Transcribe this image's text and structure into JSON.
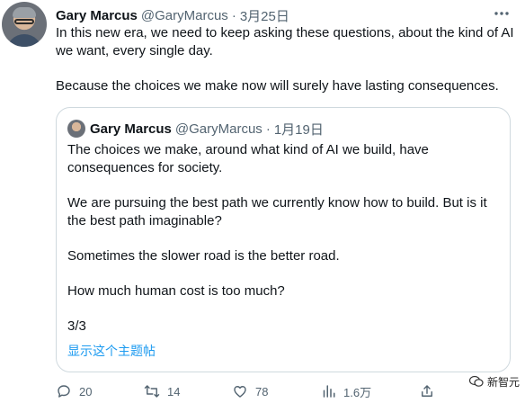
{
  "tweet": {
    "author_name": "Gary Marcus",
    "author_handle": "@GaryMarcus",
    "separator": "·",
    "date": "3月25日",
    "paragraphs": [
      "In this new era, we need to keep asking these questions, about the kind of AI we want, every single day.",
      "Because the choices we make now will surely have lasting consequences."
    ]
  },
  "quoted": {
    "author_name": "Gary Marcus",
    "author_handle": "@GaryMarcus",
    "separator": "·",
    "date": "1月19日",
    "paragraphs": [
      "The choices we make, around what kind of AI we build, have consequences for society.",
      "We are pursuing the best path we currently know how to build. But is it the best path imaginable?",
      "Sometimes the slower road is the better road.",
      "How much human cost is too much?",
      "3/3"
    ],
    "show_thread": "显示这个主题帖"
  },
  "actions": {
    "replies": "20",
    "retweets": "14",
    "likes": "78",
    "views": "1.6万"
  },
  "watermark": {
    "text": "新智元"
  },
  "icons": [
    "more-icon",
    "reply-icon",
    "retweet-icon",
    "like-icon",
    "views-icon",
    "share-icon"
  ],
  "colors": {
    "text": "#0f1419",
    "secondary": "#536471",
    "link": "#1d9bf0",
    "border": "#cfd9de"
  }
}
